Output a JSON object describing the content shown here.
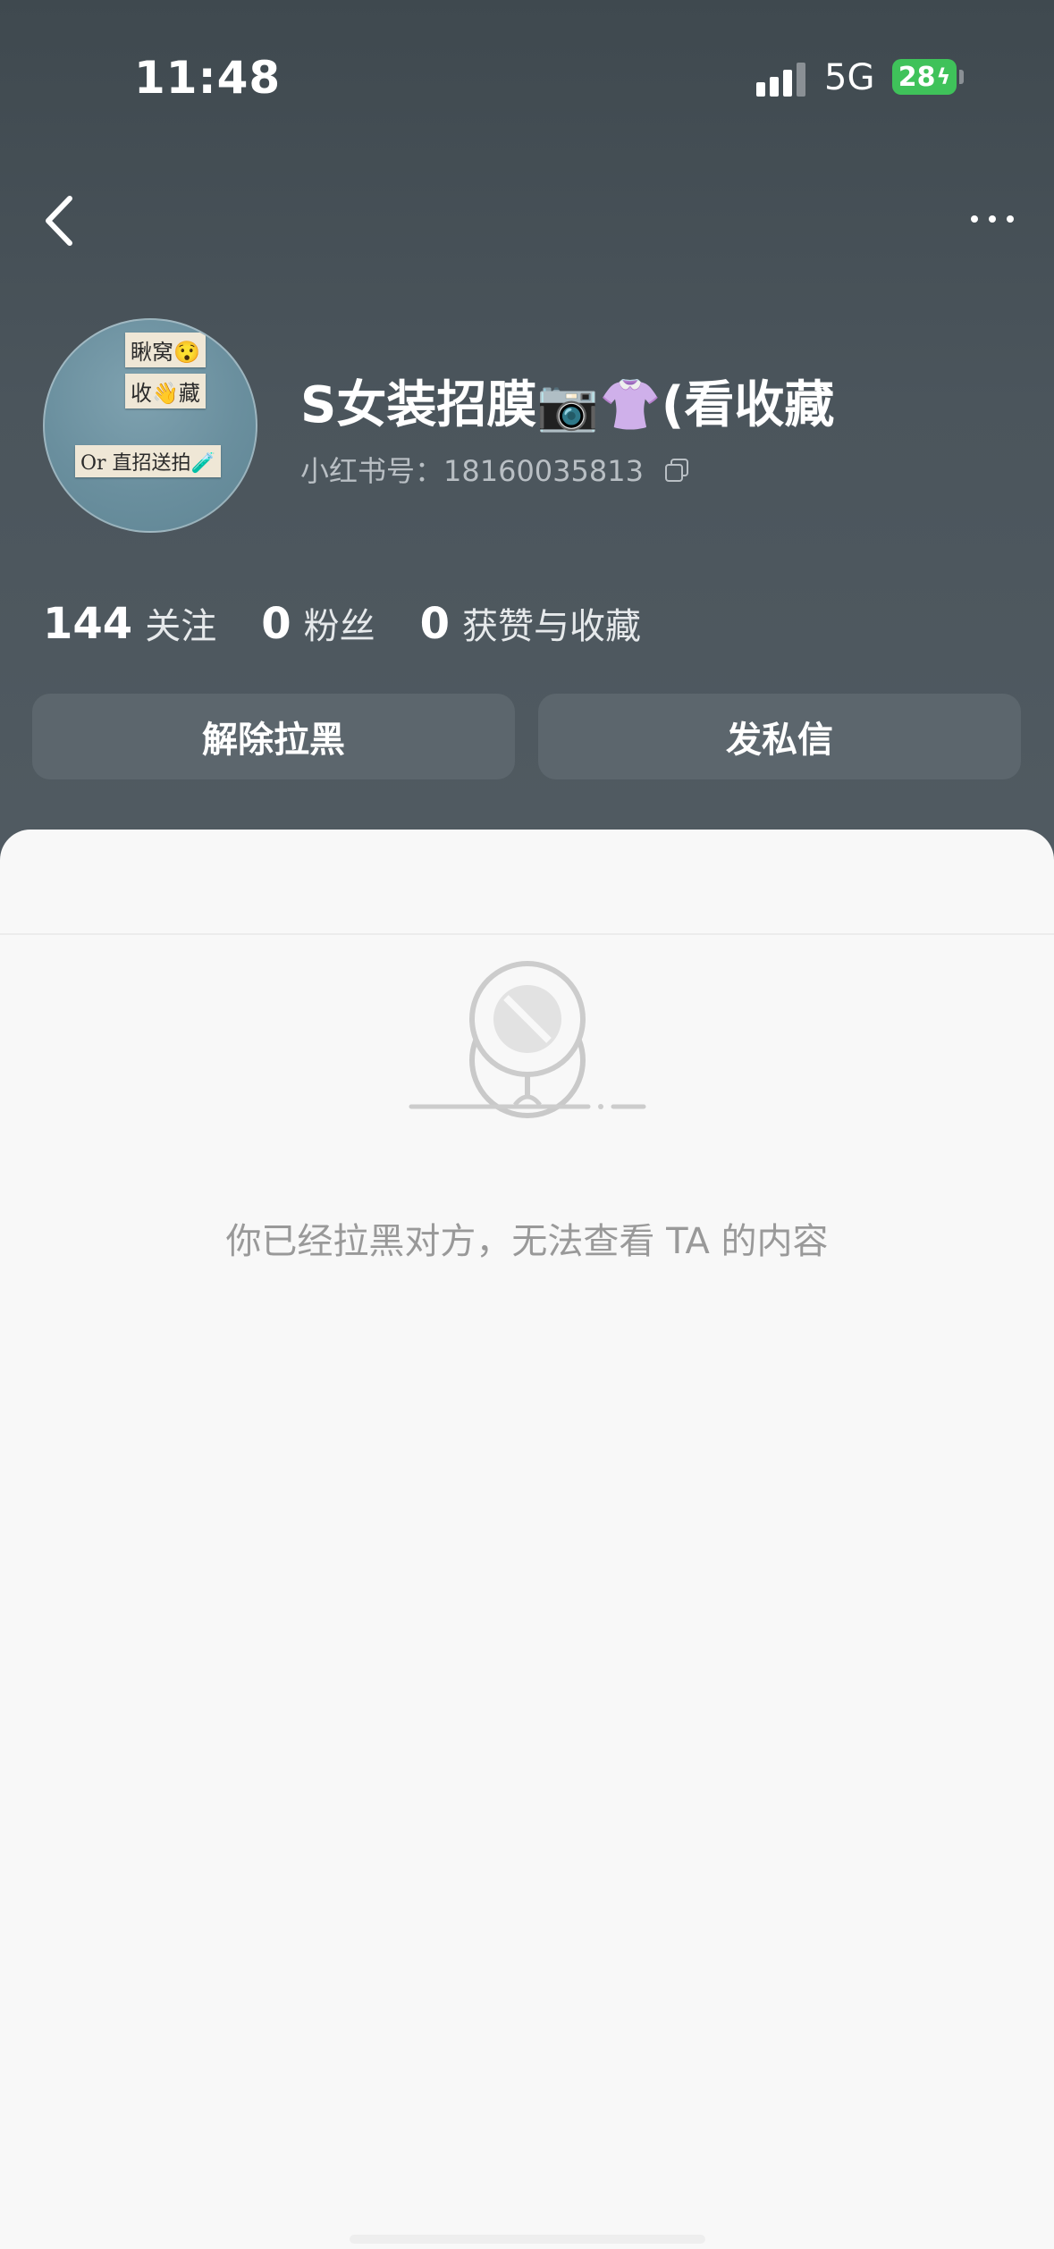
{
  "status_bar": {
    "time": "11:48",
    "network": "5G",
    "battery": "28"
  },
  "nav": {
    "back_icon": "chevron-left-icon",
    "more_icon": "more-dots-icon"
  },
  "profile": {
    "avatar_notes": [
      "瞅窝😯",
      "收👋藏",
      "Or 直招送拍🧪"
    ],
    "name": "S女装招膜📷👚(看收藏",
    "id_text": "小红书号：18160035813",
    "copy_icon": "copy-icon"
  },
  "stats": [
    {
      "value": "144",
      "label": "关注"
    },
    {
      "value": "0",
      "label": "粉丝"
    },
    {
      "value": "0",
      "label": "获赞与收藏"
    }
  ],
  "actions": {
    "unblock_label": "解除拉黑",
    "message_label": "发私信"
  },
  "content": {
    "illustration_icon": "blocked-sign-icon",
    "blocked_message": "你已经拉黑对方，无法查看 TA 的内容"
  },
  "colors": {
    "header_bg": "#4b555c",
    "button_bg": "#5c666d",
    "battery": "#3fc25a",
    "content_bg": "#f8f8f8",
    "muted_text": "#999999"
  }
}
